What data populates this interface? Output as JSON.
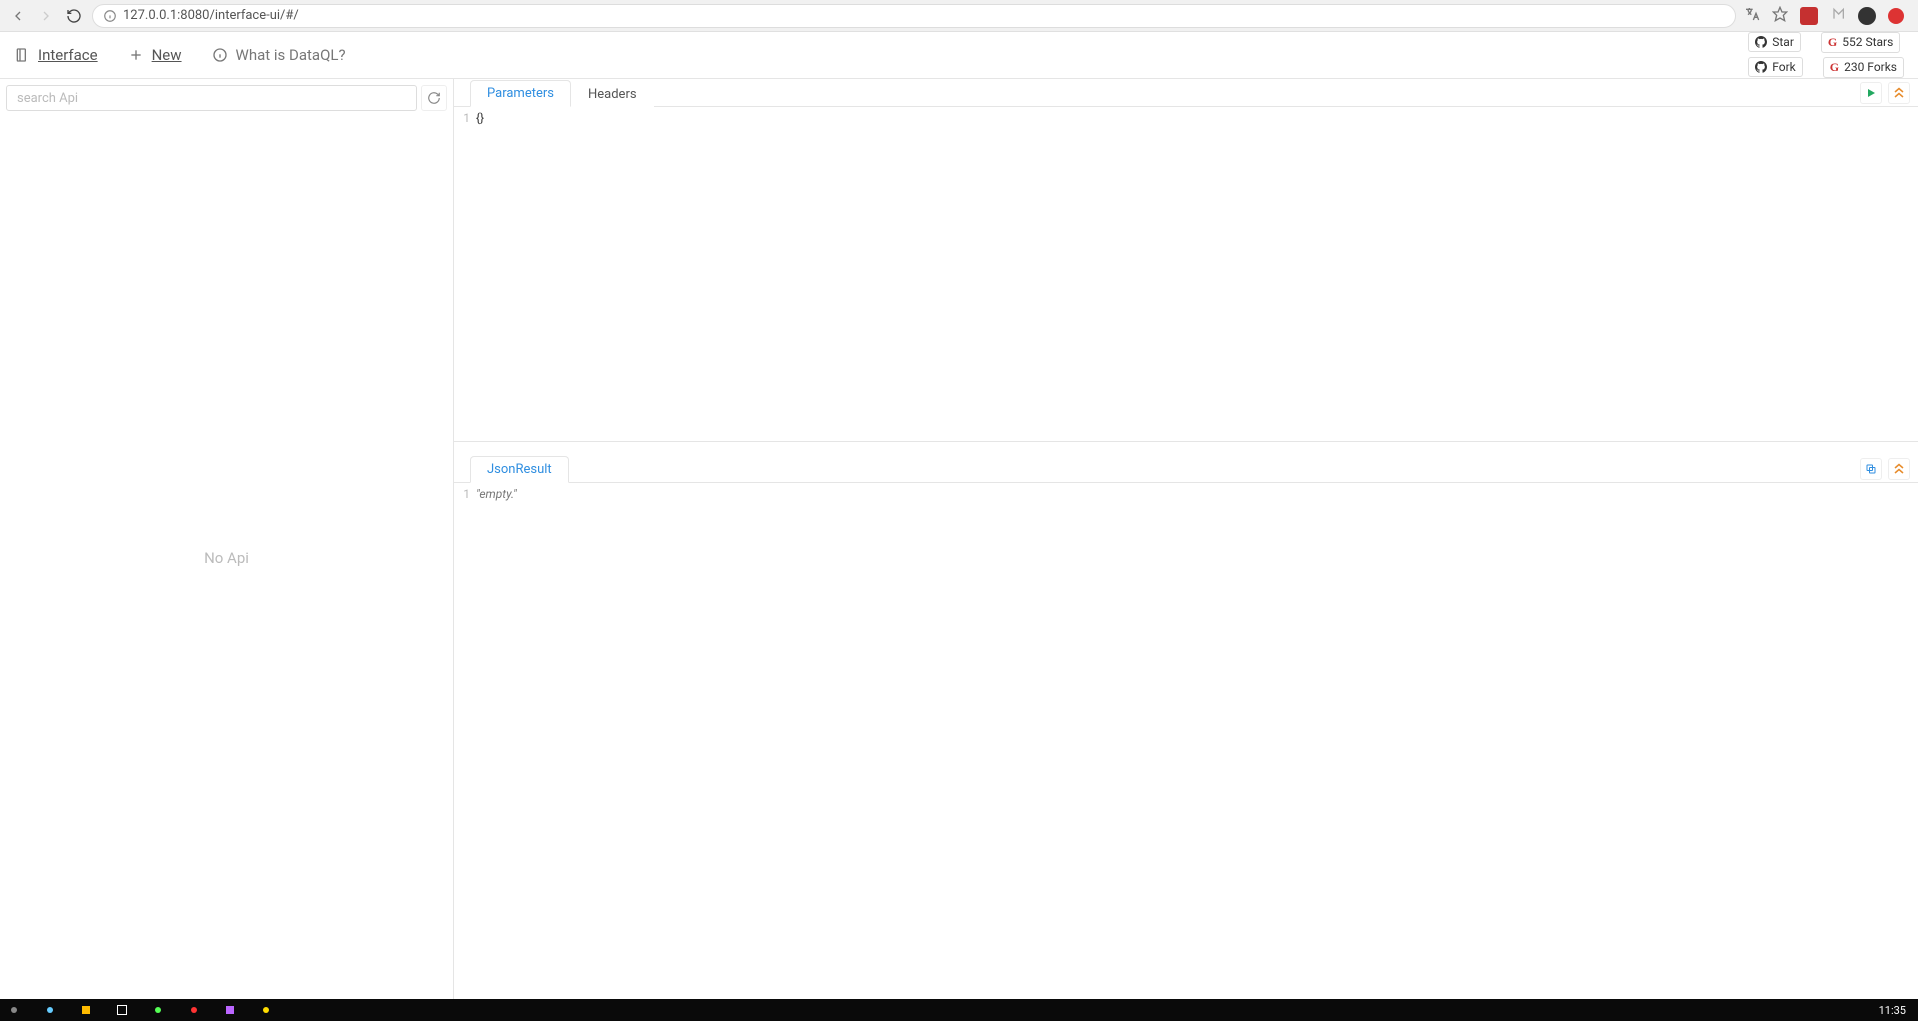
{
  "browser": {
    "url": "127.0.0.1:8080/interface-ui/#/"
  },
  "header": {
    "interface_label": "Interface",
    "new_label": "New",
    "help_label": "What is DataQL?",
    "star_label": "Star",
    "fork_label": "Fork",
    "stars_count": "552 Stars",
    "forks_count": "230 Forks"
  },
  "sidebar": {
    "search_placeholder": "search Api",
    "empty_text": "No Api"
  },
  "tabs": {
    "parameters": "Parameters",
    "headers": "Headers",
    "json_result": "JsonResult"
  },
  "editor_top": {
    "line_number": "1",
    "content": "{}"
  },
  "editor_bottom": {
    "line_number": "1",
    "content": "\"empty.\""
  },
  "taskbar": {
    "clock": "11:35"
  }
}
